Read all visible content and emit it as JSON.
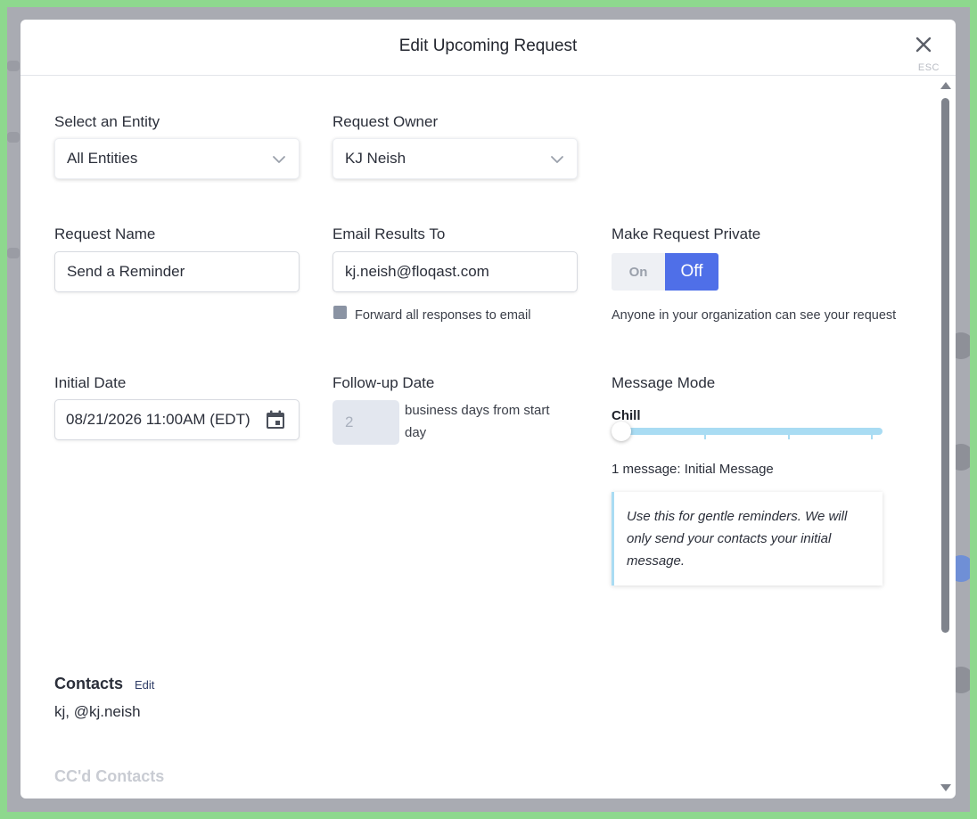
{
  "modal": {
    "title": "Edit Upcoming Request",
    "esc_label": "ESC"
  },
  "entity": {
    "label": "Select an Entity",
    "value": "All Entities"
  },
  "owner": {
    "label": "Request Owner",
    "value": "KJ Neish"
  },
  "request_name": {
    "label": "Request Name",
    "value": "Send a Reminder"
  },
  "email_results": {
    "label": "Email Results To",
    "value": "kj.neish@floqast.com",
    "forward_label": "Forward all responses to email"
  },
  "private": {
    "label": "Make Request Private",
    "on_label": "On",
    "off_label": "Off",
    "selected": "Off",
    "description": "Anyone in your organization can see your request"
  },
  "initial_date": {
    "label": "Initial Date",
    "value": "08/21/2026 11:00AM (EDT)"
  },
  "followup": {
    "label": "Follow-up Date",
    "placeholder": "2",
    "suffix": "business days from start day"
  },
  "message_mode": {
    "label": "Message Mode",
    "level_name": "Chill",
    "level": 0,
    "levels": 4,
    "message_count": "1 message: Initial Message",
    "description": "Use this for gentle reminders. We will only send your contacts your initial message."
  },
  "contacts": {
    "title": "Contacts",
    "edit_label": "Edit",
    "value": "kj, @kj.neish"
  },
  "cc_contacts": {
    "title": "CC'd Contacts"
  },
  "colors": {
    "accent": "#4f6fe8",
    "slider": "#a9dcf3",
    "frame": "#8ed88e"
  }
}
